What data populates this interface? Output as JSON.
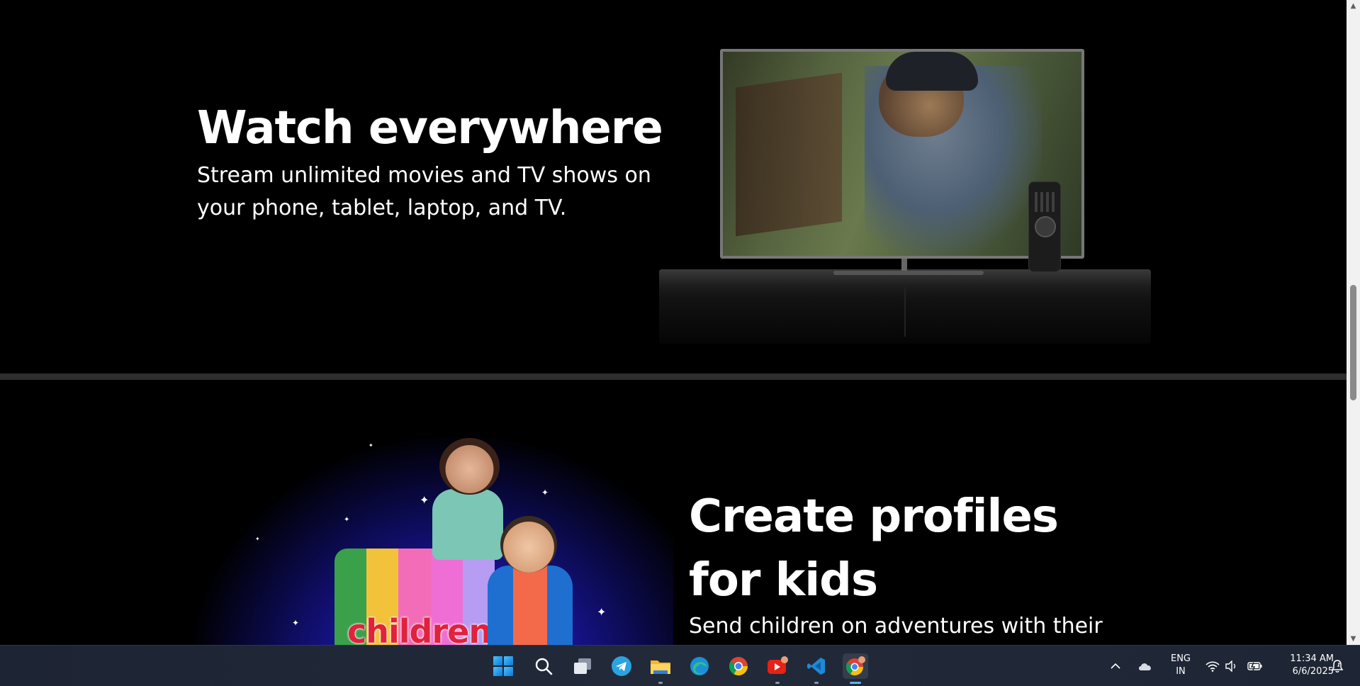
{
  "section_tv": {
    "title": "Watch everywhere",
    "description": "Stream unlimited movies and TV shows on your phone, tablet, laptop, and TV."
  },
  "section_kids": {
    "title": "Create profiles for kids",
    "description": "Send children on adventures with their",
    "badge_text": "children"
  },
  "taskbar": {
    "apps": [
      "start",
      "search",
      "task-view",
      "telegram",
      "file-explorer",
      "edge",
      "chrome",
      "youtube",
      "vscode",
      "chrome-active"
    ],
    "language_line1": "ENG",
    "language_line2": "IN",
    "time": "11:34 AM",
    "date": "6/6/2025"
  },
  "colors": {
    "background": "#000000",
    "divider": "#2e2e2e",
    "taskbar": "#1d2433",
    "kids_word": "#e0223c"
  }
}
